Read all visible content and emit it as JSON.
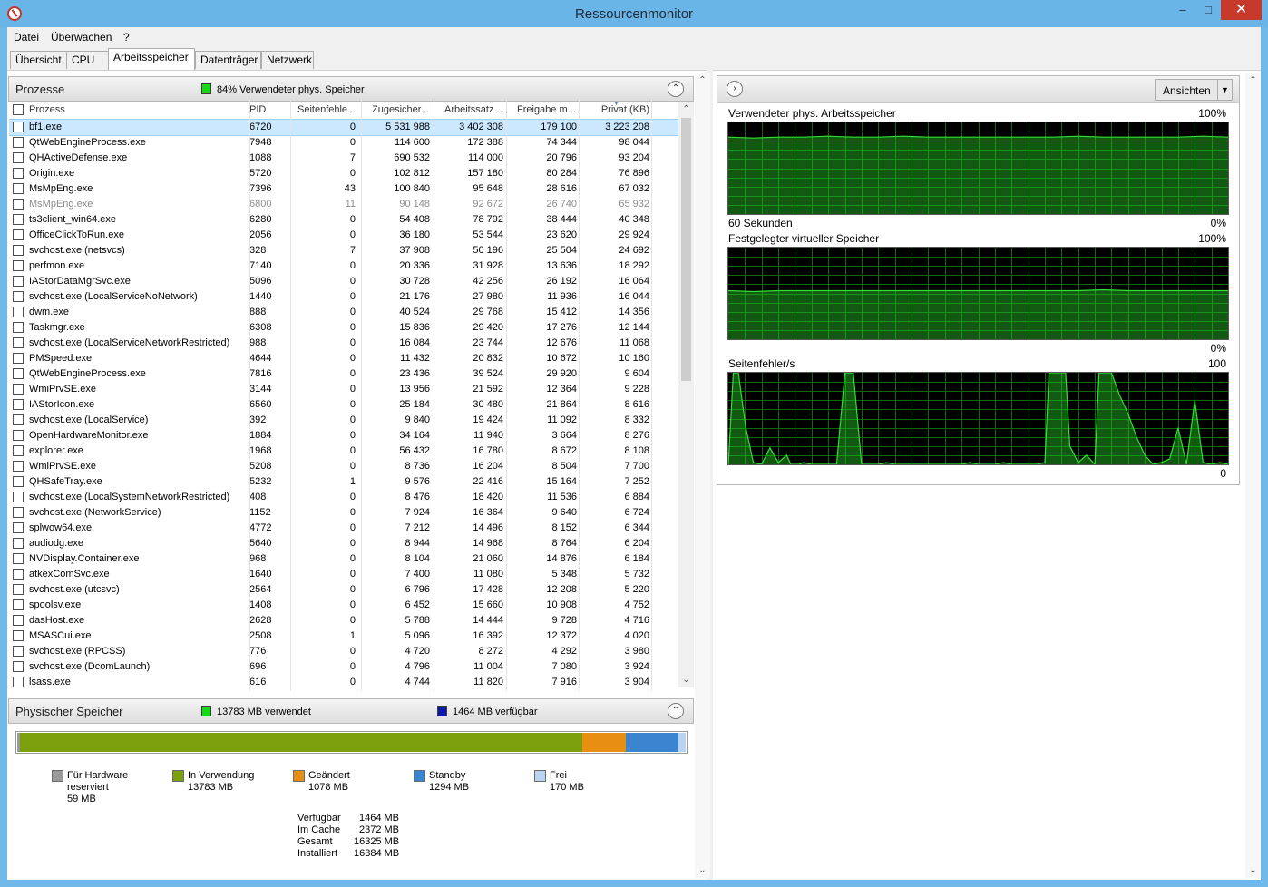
{
  "window": {
    "title": "Ressourcenmonitor",
    "min_icon": "minimize-icon",
    "max_icon": "maximize-icon",
    "close_icon": "close-icon"
  },
  "menu": {
    "datei": "Datei",
    "ueberwachen": "Überwachen",
    "help": "?"
  },
  "tabs": [
    {
      "label": "Übersicht"
    },
    {
      "label": "CPU"
    },
    {
      "label": "Arbeitsspeicher",
      "active": true
    },
    {
      "label": "Datenträger"
    },
    {
      "label": "Netzwerk"
    }
  ],
  "processes": {
    "title": "Prozesse",
    "status": "84% Verwendeter phys. Speicher",
    "status_color": "#17d817",
    "columns": {
      "name": "Prozess",
      "pid": "PID",
      "pagefaults": "Seitenfehle...",
      "commit": "Zugesicher...",
      "workingset": "Arbeitssatz ...",
      "shareable": "Freigabe m...",
      "private": "Privat (KB)"
    },
    "rows": [
      {
        "name": "bf1.exe",
        "pid": "6720",
        "pf": "0",
        "commit": "5 531 988",
        "ws": "3 402 308",
        "share": "179 100",
        "priv": "3 223 208",
        "selected": true
      },
      {
        "name": "QtWebEngineProcess.exe",
        "pid": "7948",
        "pf": "0",
        "commit": "114 600",
        "ws": "172 388",
        "share": "74 344",
        "priv": "98 044"
      },
      {
        "name": "QHActiveDefense.exe",
        "pid": "1088",
        "pf": "7",
        "commit": "690 532",
        "ws": "114 000",
        "share": "20 796",
        "priv": "93 204"
      },
      {
        "name": "Origin.exe",
        "pid": "5720",
        "pf": "0",
        "commit": "102 812",
        "ws": "157 180",
        "share": "80 284",
        "priv": "76 896"
      },
      {
        "name": "MsMpEng.exe",
        "pid": "7396",
        "pf": "43",
        "commit": "100 840",
        "ws": "95 648",
        "share": "28 616",
        "priv": "67 032"
      },
      {
        "name": "MsMpEng.exe",
        "pid": "6800",
        "pf": "11",
        "commit": "90 148",
        "ws": "92 672",
        "share": "26 740",
        "priv": "65 932",
        "dim": true
      },
      {
        "name": "ts3client_win64.exe",
        "pid": "6280",
        "pf": "0",
        "commit": "54 408",
        "ws": "78 792",
        "share": "38 444",
        "priv": "40 348"
      },
      {
        "name": "OfficeClickToRun.exe",
        "pid": "2056",
        "pf": "0",
        "commit": "36 180",
        "ws": "53 544",
        "share": "23 620",
        "priv": "29 924"
      },
      {
        "name": "svchost.exe (netsvcs)",
        "pid": "328",
        "pf": "7",
        "commit": "37 908",
        "ws": "50 196",
        "share": "25 504",
        "priv": "24 692"
      },
      {
        "name": "perfmon.exe",
        "pid": "7140",
        "pf": "0",
        "commit": "20 336",
        "ws": "31 928",
        "share": "13 636",
        "priv": "18 292"
      },
      {
        "name": "IAStorDataMgrSvc.exe",
        "pid": "5096",
        "pf": "0",
        "commit": "30 728",
        "ws": "42 256",
        "share": "26 192",
        "priv": "16 064"
      },
      {
        "name": "svchost.exe (LocalServiceNoNetwork)",
        "pid": "1440",
        "pf": "0",
        "commit": "21 176",
        "ws": "27 980",
        "share": "11 936",
        "priv": "16 044"
      },
      {
        "name": "dwm.exe",
        "pid": "888",
        "pf": "0",
        "commit": "40 524",
        "ws": "29 768",
        "share": "15 412",
        "priv": "14 356"
      },
      {
        "name": "Taskmgr.exe",
        "pid": "6308",
        "pf": "0",
        "commit": "15 836",
        "ws": "29 420",
        "share": "17 276",
        "priv": "12 144"
      },
      {
        "name": "svchost.exe (LocalServiceNetworkRestricted)",
        "pid": "988",
        "pf": "0",
        "commit": "16 084",
        "ws": "23 744",
        "share": "12 676",
        "priv": "11 068"
      },
      {
        "name": "PMSpeed.exe",
        "pid": "4644",
        "pf": "0",
        "commit": "11 432",
        "ws": "20 832",
        "share": "10 672",
        "priv": "10 160"
      },
      {
        "name": "QtWebEngineProcess.exe",
        "pid": "7816",
        "pf": "0",
        "commit": "23 436",
        "ws": "39 524",
        "share": "29 920",
        "priv": "9 604"
      },
      {
        "name": "WmiPrvSE.exe",
        "pid": "3144",
        "pf": "0",
        "commit": "13 956",
        "ws": "21 592",
        "share": "12 364",
        "priv": "9 228"
      },
      {
        "name": "IAStorIcon.exe",
        "pid": "6560",
        "pf": "0",
        "commit": "25 184",
        "ws": "30 480",
        "share": "21 864",
        "priv": "8 616"
      },
      {
        "name": "svchost.exe (LocalService)",
        "pid": "392",
        "pf": "0",
        "commit": "9 840",
        "ws": "19 424",
        "share": "11 092",
        "priv": "8 332"
      },
      {
        "name": "OpenHardwareMonitor.exe",
        "pid": "1884",
        "pf": "0",
        "commit": "34 164",
        "ws": "11 940",
        "share": "3 664",
        "priv": "8 276"
      },
      {
        "name": "explorer.exe",
        "pid": "1968",
        "pf": "0",
        "commit": "56 432",
        "ws": "16 780",
        "share": "8 672",
        "priv": "8 108"
      },
      {
        "name": "WmiPrvSE.exe",
        "pid": "5208",
        "pf": "0",
        "commit": "8 736",
        "ws": "16 204",
        "share": "8 504",
        "priv": "7 700"
      },
      {
        "name": "QHSafeTray.exe",
        "pid": "5232",
        "pf": "1",
        "commit": "9 576",
        "ws": "22 416",
        "share": "15 164",
        "priv": "7 252"
      },
      {
        "name": "svchost.exe (LocalSystemNetworkRestricted)",
        "pid": "408",
        "pf": "0",
        "commit": "8 476",
        "ws": "18 420",
        "share": "11 536",
        "priv": "6 884"
      },
      {
        "name": "svchost.exe (NetworkService)",
        "pid": "1152",
        "pf": "0",
        "commit": "7 924",
        "ws": "16 364",
        "share": "9 640",
        "priv": "6 724"
      },
      {
        "name": "splwow64.exe",
        "pid": "4772",
        "pf": "0",
        "commit": "7 212",
        "ws": "14 496",
        "share": "8 152",
        "priv": "6 344"
      },
      {
        "name": "audiodg.exe",
        "pid": "5640",
        "pf": "0",
        "commit": "8 944",
        "ws": "14 968",
        "share": "8 764",
        "priv": "6 204"
      },
      {
        "name": "NVDisplay.Container.exe",
        "pid": "968",
        "pf": "0",
        "commit": "8 104",
        "ws": "21 060",
        "share": "14 876",
        "priv": "6 184"
      },
      {
        "name": "atkexComSvc.exe",
        "pid": "1640",
        "pf": "0",
        "commit": "7 400",
        "ws": "11 080",
        "share": "5 348",
        "priv": "5 732"
      },
      {
        "name": "svchost.exe (utcsvc)",
        "pid": "2564",
        "pf": "0",
        "commit": "6 796",
        "ws": "17 428",
        "share": "12 208",
        "priv": "5 220"
      },
      {
        "name": "spoolsv.exe",
        "pid": "1408",
        "pf": "0",
        "commit": "6 452",
        "ws": "15 660",
        "share": "10 908",
        "priv": "4 752"
      },
      {
        "name": "dasHost.exe",
        "pid": "2628",
        "pf": "0",
        "commit": "5 788",
        "ws": "14 444",
        "share": "9 728",
        "priv": "4 716"
      },
      {
        "name": "MSASCui.exe",
        "pid": "2508",
        "pf": "1",
        "commit": "5 096",
        "ws": "16 392",
        "share": "12 372",
        "priv": "4 020"
      },
      {
        "name": "svchost.exe (RPCSS)",
        "pid": "776",
        "pf": "0",
        "commit": "4 720",
        "ws": "8 272",
        "share": "4 292",
        "priv": "3 980"
      },
      {
        "name": "svchost.exe (DcomLaunch)",
        "pid": "696",
        "pf": "0",
        "commit": "4 796",
        "ws": "11 004",
        "share": "7 080",
        "priv": "3 924"
      },
      {
        "name": "lsass.exe",
        "pid": "616",
        "pf": "0",
        "commit": "4 744",
        "ws": "11 820",
        "share": "7 916",
        "priv": "3 904"
      }
    ]
  },
  "physical": {
    "title": "Physischer Speicher",
    "used_status": "13783 MB verwendet",
    "used_color": "#17d817",
    "avail_status": "1464 MB verfügbar",
    "avail_color": "#0a1aa8",
    "segments": [
      {
        "name": "Für Hardware reserviert",
        "mb": 59,
        "color": "#9a9a9a"
      },
      {
        "name": "In Verwendung",
        "mb": 13783,
        "color": "#7ba00c"
      },
      {
        "name": "Geändert",
        "mb": 1078,
        "color": "#e88e10"
      },
      {
        "name": "Standby",
        "mb": 1294,
        "color": "#3a84d0"
      },
      {
        "name": "Frei",
        "mb": 170,
        "color": "#b8d4f2"
      }
    ],
    "legend": {
      "hw_line1": "Für Hardware",
      "hw_line2": "reserviert",
      "hw_value": "59 MB",
      "inuse_label": "In Verwendung",
      "inuse_value": "13783 MB",
      "modified_label": "Geändert",
      "modified_value": "1078 MB",
      "standby_label": "Standby",
      "standby_value": "1294 MB",
      "free_label": "Frei",
      "free_value": "170 MB"
    },
    "summary": [
      {
        "k": "Verfügbar",
        "v": "1464 MB"
      },
      {
        "k": "Im Cache",
        "v": "2372 MB"
      },
      {
        "k": "Gesamt",
        "v": "16325 MB"
      },
      {
        "k": "Installiert",
        "v": "16384 MB"
      }
    ]
  },
  "right": {
    "expand_icon": "chevron-right-icon",
    "views_label": "Ansichten",
    "graphs": [
      {
        "title": "Verwendeter phys. Arbeitsspeicher",
        "max": "100%",
        "min": "0%",
        "time": "60 Sekunden"
      },
      {
        "title": "Festgelegter virtueller Speicher",
        "max": "100%",
        "min": "0%",
        "time": ""
      },
      {
        "title": "Seitenfehler/s",
        "max": "100",
        "min": "0",
        "time": ""
      }
    ]
  },
  "chart_data": [
    {
      "type": "area",
      "title": "Verwendeter phys. Arbeitsspeicher",
      "ylim": [
        0,
        100
      ],
      "x": [
        0,
        3,
        6,
        9,
        12,
        15,
        18,
        21,
        24,
        27,
        30,
        33,
        36,
        39,
        42,
        45,
        48,
        51,
        54,
        57,
        60
      ],
      "values": [
        84,
        83,
        84,
        84,
        85,
        84,
        84,
        85,
        84,
        84,
        84,
        84,
        84,
        84,
        85,
        84,
        84,
        84,
        84,
        85,
        84
      ]
    },
    {
      "type": "area",
      "title": "Festgelegter virtueller Speicher",
      "ylim": [
        0,
        100
      ],
      "x": [
        0,
        3,
        6,
        9,
        12,
        15,
        18,
        21,
        24,
        27,
        30,
        33,
        36,
        39,
        42,
        45,
        48,
        51,
        54,
        57,
        60
      ],
      "values": [
        53,
        52,
        53,
        53,
        53,
        53,
        53,
        53,
        53,
        53,
        53,
        53,
        53,
        53,
        53,
        54,
        53,
        53,
        53,
        53,
        53
      ]
    },
    {
      "type": "area",
      "title": "Seitenfehler/s",
      "ylim": [
        0,
        100
      ],
      "x": [
        0,
        0.6,
        1.2,
        2.1,
        3,
        4,
        5,
        6,
        7,
        7.5,
        8.5,
        9,
        10,
        11,
        12,
        13,
        14,
        15,
        16,
        17,
        18,
        19,
        20,
        21,
        22,
        23,
        24,
        25,
        26,
        27,
        28,
        29,
        30,
        31,
        32,
        33,
        34,
        35,
        36,
        37,
        38,
        38.5,
        39.5,
        40,
        40.5,
        41,
        42,
        43,
        44,
        44.5,
        45.5,
        46,
        47,
        48,
        49,
        50,
        51,
        52,
        53,
        54,
        55,
        56,
        57,
        58,
        59,
        60
      ],
      "values": [
        0,
        100,
        100,
        40,
        2,
        0,
        18,
        2,
        10,
        0,
        0,
        2,
        0,
        0,
        0,
        0,
        100,
        100,
        0,
        0,
        0,
        2,
        0,
        0,
        0,
        0,
        0,
        0,
        0,
        0,
        0,
        2,
        0,
        0,
        0,
        2,
        0,
        0,
        0,
        0,
        2,
        100,
        100,
        100,
        100,
        20,
        2,
        10,
        0,
        100,
        100,
        100,
        75,
        55,
        30,
        10,
        0,
        2,
        6,
        40,
        0,
        70,
        2,
        0,
        2,
        0
      ]
    }
  ]
}
